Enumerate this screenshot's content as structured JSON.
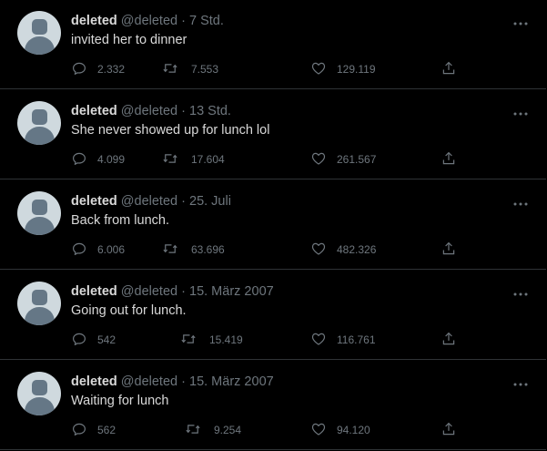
{
  "colors": {
    "background": "#000000",
    "divider": "#2f3336",
    "text": "#d9d9d9",
    "muted": "#6e767d",
    "avatar_bg": "#cfd9de",
    "avatar_fg": "#657786"
  },
  "icons": {
    "reply": "reply-icon",
    "retweet": "retweet-icon",
    "like": "heart-icon",
    "share": "share-icon",
    "more": "more-icon"
  },
  "tweets": [
    {
      "name": "deleted",
      "handle": "@deleted",
      "separator": "·",
      "time": "7 Std.",
      "text": "invited her to dinner",
      "replies": "2.332",
      "retweets": "7.553",
      "likes": "129.119"
    },
    {
      "name": "deleted",
      "handle": "@deleted",
      "separator": "·",
      "time": "13 Std.",
      "text": "She never showed up for lunch lol",
      "replies": "4.099",
      "retweets": "17.604",
      "likes": "261.567"
    },
    {
      "name": "deleted",
      "handle": "@deleted",
      "separator": "·",
      "time": "25. Juli",
      "text": "Back from lunch.",
      "replies": "6.006",
      "retweets": "63.696",
      "likes": "482.326"
    },
    {
      "name": "deleted",
      "handle": "@deleted",
      "separator": "·",
      "time": "15. März 2007",
      "text": "Going out for lunch.",
      "replies": "542",
      "retweets": "15.419",
      "likes": "116.761"
    },
    {
      "name": "deleted",
      "handle": "@deleted",
      "separator": "·",
      "time": "15. März 2007",
      "text": "Waiting for lunch",
      "replies": "562",
      "retweets": "9.254",
      "likes": "94.120"
    }
  ]
}
